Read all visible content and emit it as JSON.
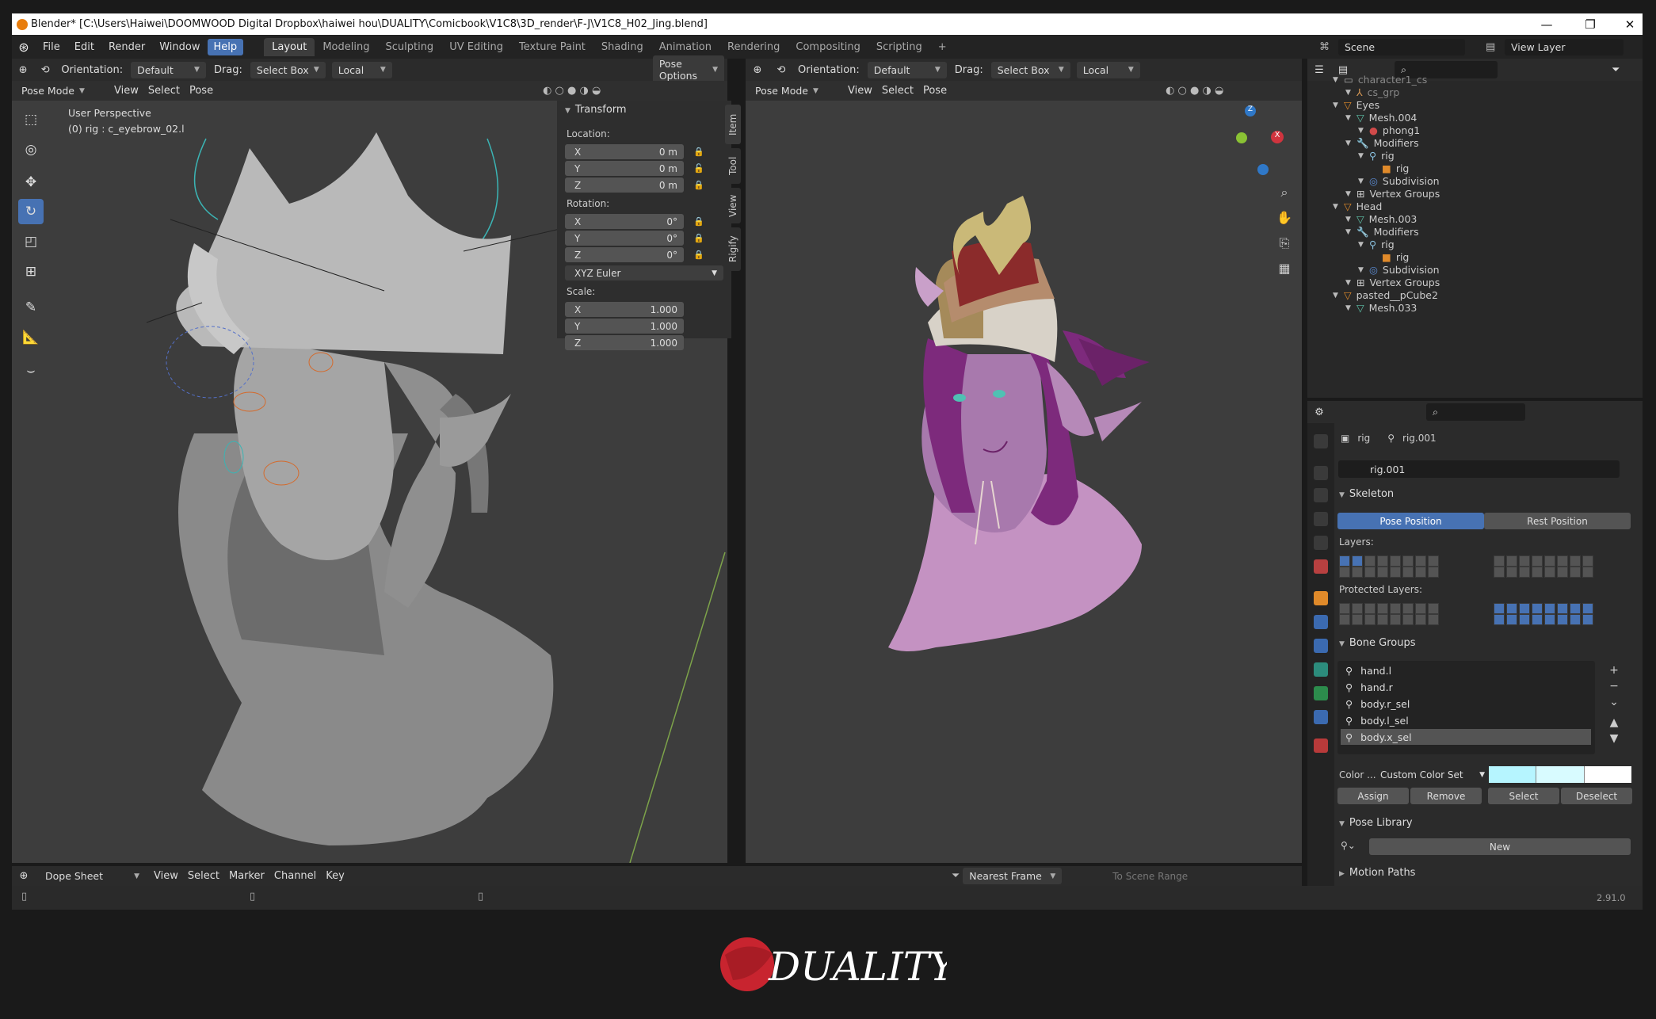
{
  "titlebar": {
    "title": "Blender* [C:\\Users\\Haiwei\\DOOMWOOD Digital Dropbox\\haiwei hou\\DUALITY\\Comicbook\\V1C8\\3D_render\\F-J\\V1C8_H02_Jing.blend]",
    "minimize": "—",
    "restore": "❐",
    "close": "✕"
  },
  "menu": {
    "items": [
      "File",
      "Edit",
      "Render",
      "Window",
      "Help"
    ],
    "workspaces": [
      "Layout",
      "Modeling",
      "Sculpting",
      "UV Editing",
      "Texture Paint",
      "Shading",
      "Animation",
      "Rendering",
      "Compositing",
      "Scripting"
    ],
    "add": "+",
    "scene_label": "Scene",
    "view_layer_label": "View Layer"
  },
  "left_viewport": {
    "orientation_label": "Orientation:",
    "orientation_value": "Default",
    "drag_label": "Drag:",
    "drag_value": "Select Box",
    "pivot_value": "Local",
    "mode": "Pose Mode",
    "menus": [
      "View",
      "Select",
      "Pose"
    ],
    "pose_options": "Pose Options",
    "perspective": "User Perspective",
    "active": "(0) rig : c_eyebrow_02.l"
  },
  "transform_panel": {
    "title": "Transform",
    "location_label": "Location:",
    "rotation_label": "Rotation:",
    "scale_label": "Scale:",
    "location": [
      {
        "axis": "X",
        "value": "0 m"
      },
      {
        "axis": "Y",
        "value": "0 m"
      },
      {
        "axis": "Z",
        "value": "0 m"
      }
    ],
    "rotation": [
      {
        "axis": "X",
        "value": "0°"
      },
      {
        "axis": "Y",
        "value": "0°"
      },
      {
        "axis": "Z",
        "value": "0°"
      }
    ],
    "rotation_mode": "XYZ Euler",
    "scale": [
      {
        "axis": "X",
        "value": "1.000"
      },
      {
        "axis": "Y",
        "value": "1.000"
      },
      {
        "axis": "Z",
        "value": "1.000"
      }
    ],
    "tabs": [
      "Item",
      "Tool",
      "View",
      "Rigify"
    ]
  },
  "right_viewport": {
    "orientation_label": "Orientation:",
    "orientation_value": "Default",
    "drag_label": "Drag:",
    "drag_value": "Select Box",
    "pivot_value": "Local",
    "mode": "Pose Mode",
    "menus": [
      "View",
      "Select",
      "Pose"
    ],
    "gizmo": {
      "z": "Z",
      "x": "X"
    }
  },
  "outliner": {
    "rows": [
      {
        "label": "character1_cs",
        "indent": 2,
        "icon": "collection",
        "color": "#888"
      },
      {
        "label": "cs_grp",
        "indent": 3,
        "icon": "empty",
        "color": "#888"
      },
      {
        "label": "Eyes",
        "indent": 2,
        "icon": "object",
        "color": "#ccc"
      },
      {
        "label": "Mesh.004",
        "indent": 3,
        "icon": "mesh",
        "color": "#ccc"
      },
      {
        "label": "phong1",
        "indent": 4,
        "icon": "material",
        "color": "#ccc"
      },
      {
        "label": "Modifiers",
        "indent": 3,
        "icon": "wrench",
        "color": "#ccc"
      },
      {
        "label": "rig",
        "indent": 4,
        "icon": "armature",
        "color": "#ccc"
      },
      {
        "label": "rig",
        "indent": 5,
        "icon": "bone-data",
        "color": "#ccc"
      },
      {
        "label": "Subdivision",
        "indent": 4,
        "icon": "modifier",
        "color": "#ccc"
      },
      {
        "label": "Vertex Groups",
        "indent": 3,
        "icon": "vgroup",
        "color": "#ccc"
      },
      {
        "label": "Head",
        "indent": 2,
        "icon": "object",
        "color": "#ccc"
      },
      {
        "label": "Mesh.003",
        "indent": 3,
        "icon": "mesh",
        "color": "#ccc"
      },
      {
        "label": "Modifiers",
        "indent": 3,
        "icon": "wrench",
        "color": "#ccc"
      },
      {
        "label": "rig",
        "indent": 4,
        "icon": "armature",
        "color": "#ccc"
      },
      {
        "label": "rig",
        "indent": 5,
        "icon": "bone-data",
        "color": "#ccc"
      },
      {
        "label": "Subdivision",
        "indent": 4,
        "icon": "modifier",
        "color": "#ccc"
      },
      {
        "label": "Vertex Groups",
        "indent": 3,
        "icon": "vgroup",
        "color": "#ccc"
      },
      {
        "label": "pasted__pCube2",
        "indent": 2,
        "icon": "object",
        "color": "#ccc"
      },
      {
        "label": "Mesh.033",
        "indent": 3,
        "icon": "mesh",
        "color": "#ccc"
      }
    ]
  },
  "properties": {
    "breadcrumb_object": "rig",
    "breadcrumb_data": "rig.001",
    "datablock": "rig.001",
    "skeleton": {
      "title": "Skeleton",
      "pose_position": "Pose Position",
      "rest_position": "Rest Position",
      "layers_label": "Layers:",
      "protected_label": "Protected Layers:"
    },
    "bone_groups": {
      "title": "Bone Groups",
      "items": [
        "hand.l",
        "hand.r",
        "body.r_sel",
        "body.l_sel",
        "body.x_sel"
      ],
      "color_label": "Color ...",
      "color_set": "Custom Color Set",
      "swatches": [
        "#b6f5ff",
        "#d8fbff",
        "#ffffff"
      ],
      "assign": "Assign",
      "remove": "Remove",
      "select": "Select",
      "deselect": "Deselect"
    },
    "pose_library": {
      "title": "Pose Library",
      "new": "New"
    },
    "motion_paths": {
      "title": "Motion Paths"
    }
  },
  "dopesheet": {
    "mode": "Dope Sheet",
    "menus": [
      "View",
      "Select",
      "Marker",
      "Channel",
      "Key"
    ],
    "snap": "Nearest Frame",
    "to_scene_range": "To Scene Range"
  },
  "status": {
    "version": "2.91.0"
  },
  "logo": {
    "text": "DUALITY"
  }
}
